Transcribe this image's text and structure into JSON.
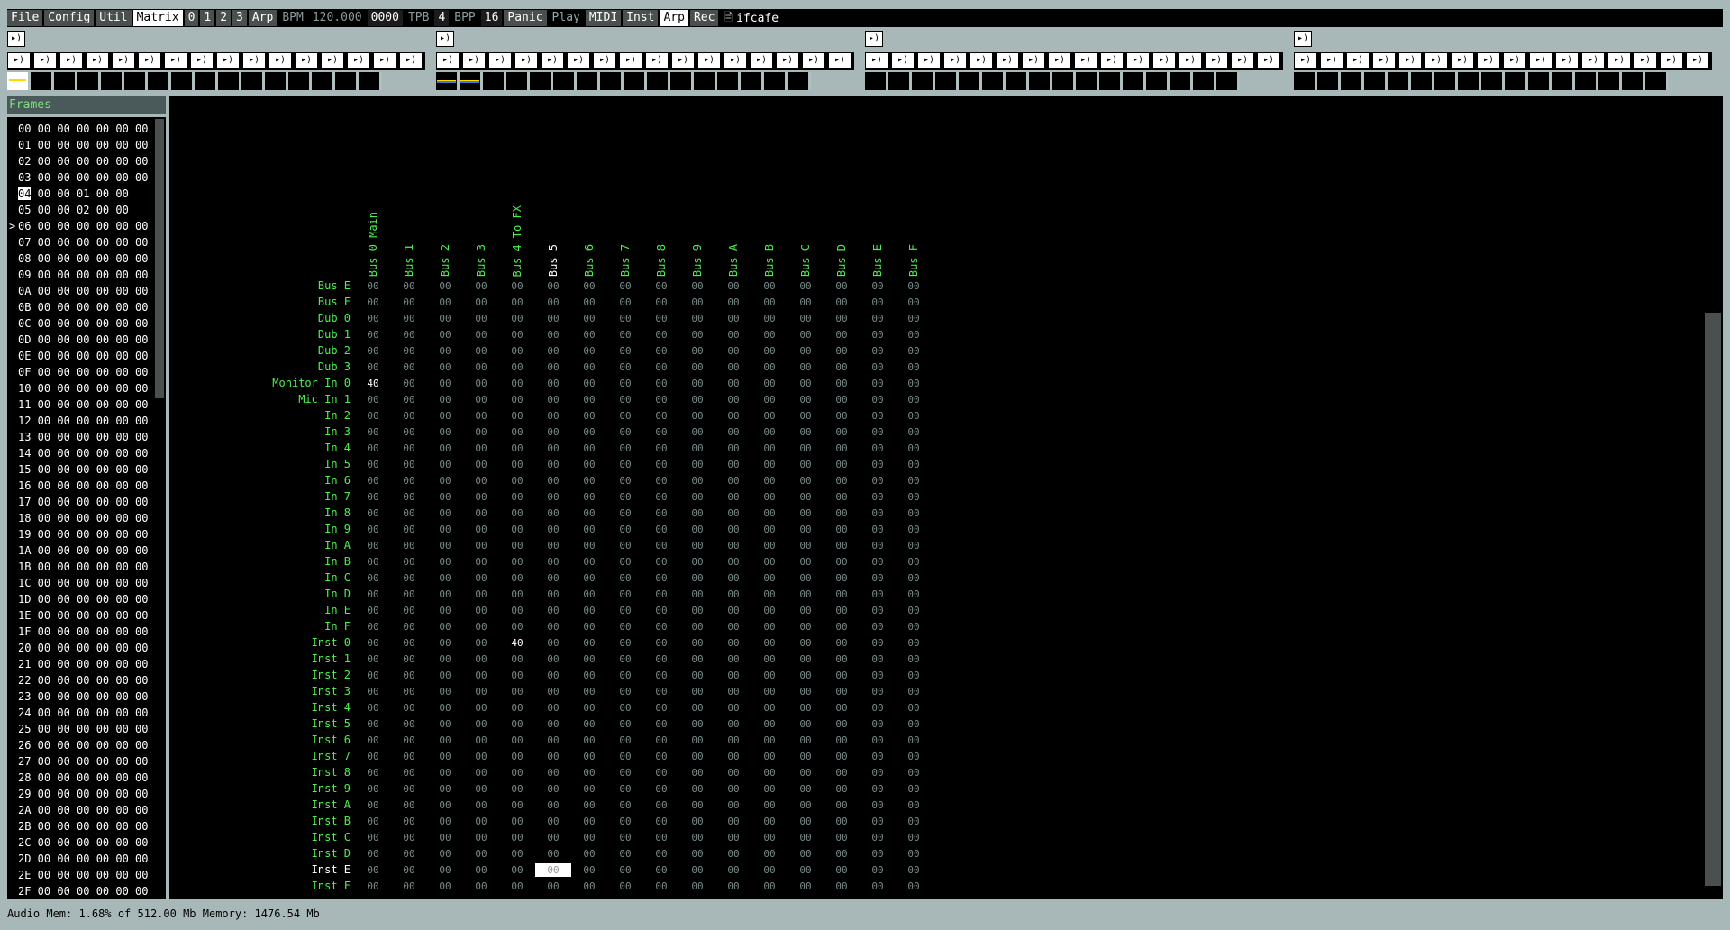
{
  "menubar": {
    "items": [
      "File",
      "Config",
      "Util",
      "Matrix",
      "0",
      "1",
      "2",
      "3",
      "Arp"
    ],
    "selected": "Matrix",
    "bpm_label": "BPM",
    "bpm_value": "120.000",
    "counter": "0000",
    "tpb_label": "TPB",
    "tpb_value": "4",
    "bpp_label": "BPP",
    "bpp_value": "16",
    "panic": "Panic",
    "play": "Play",
    "midi": "MIDI",
    "inst": "Inst",
    "arp": "Arp",
    "rec": "Rec",
    "song_name": "ifcafe"
  },
  "strip": {
    "group_button_icon": "speaker-icon",
    "channel_button_icon": "speaker-icon",
    "groups": 4,
    "channels_per_group": 16
  },
  "frames": {
    "title": "Frames",
    "current_marker": ">",
    "current_index": 6,
    "highlighted_index": 4,
    "rows": [
      {
        "idx": "00",
        "vals": "00 00 00 00 00 00"
      },
      {
        "idx": "01",
        "vals": "00 00 00 00 00 00"
      },
      {
        "idx": "02",
        "vals": "00 00 00 00 00 00"
      },
      {
        "idx": "03",
        "vals": "00 00 00 00 00 00"
      },
      {
        "idx": "04",
        "vals": "00 00 01 00 00"
      },
      {
        "idx": "05",
        "vals": "00 00 02 00 00"
      },
      {
        "idx": "06",
        "vals": "00 00 00 00 00 00"
      },
      {
        "idx": "07",
        "vals": "00 00 00 00 00 00"
      },
      {
        "idx": "08",
        "vals": "00 00 00 00 00 00"
      },
      {
        "idx": "09",
        "vals": "00 00 00 00 00 00"
      },
      {
        "idx": "0A",
        "vals": "00 00 00 00 00 00"
      },
      {
        "idx": "0B",
        "vals": "00 00 00 00 00 00"
      },
      {
        "idx": "0C",
        "vals": "00 00 00 00 00 00"
      },
      {
        "idx": "0D",
        "vals": "00 00 00 00 00 00"
      },
      {
        "idx": "0E",
        "vals": "00 00 00 00 00 00"
      },
      {
        "idx": "0F",
        "vals": "00 00 00 00 00 00"
      },
      {
        "idx": "10",
        "vals": "00 00 00 00 00 00"
      },
      {
        "idx": "11",
        "vals": "00 00 00 00 00 00"
      },
      {
        "idx": "12",
        "vals": "00 00 00 00 00 00"
      },
      {
        "idx": "13",
        "vals": "00 00 00 00 00 00"
      },
      {
        "idx": "14",
        "vals": "00 00 00 00 00 00"
      },
      {
        "idx": "15",
        "vals": "00 00 00 00 00 00"
      },
      {
        "idx": "16",
        "vals": "00 00 00 00 00 00"
      },
      {
        "idx": "17",
        "vals": "00 00 00 00 00 00"
      },
      {
        "idx": "18",
        "vals": "00 00 00 00 00 00"
      },
      {
        "idx": "19",
        "vals": "00 00 00 00 00 00"
      },
      {
        "idx": "1A",
        "vals": "00 00 00 00 00 00"
      },
      {
        "idx": "1B",
        "vals": "00 00 00 00 00 00"
      },
      {
        "idx": "1C",
        "vals": "00 00 00 00 00 00"
      },
      {
        "idx": "1D",
        "vals": "00 00 00 00 00 00"
      },
      {
        "idx": "1E",
        "vals": "00 00 00 00 00 00"
      },
      {
        "idx": "1F",
        "vals": "00 00 00 00 00 00"
      },
      {
        "idx": "20",
        "vals": "00 00 00 00 00 00"
      },
      {
        "idx": "21",
        "vals": "00 00 00 00 00 00"
      },
      {
        "idx": "22",
        "vals": "00 00 00 00 00 00"
      },
      {
        "idx": "23",
        "vals": "00 00 00 00 00 00"
      },
      {
        "idx": "24",
        "vals": "00 00 00 00 00 00"
      },
      {
        "idx": "25",
        "vals": "00 00 00 00 00 00"
      },
      {
        "idx": "26",
        "vals": "00 00 00 00 00 00"
      },
      {
        "idx": "27",
        "vals": "00 00 00 00 00 00"
      },
      {
        "idx": "28",
        "vals": "00 00 00 00 00 00"
      },
      {
        "idx": "29",
        "vals": "00 00 00 00 00 00"
      },
      {
        "idx": "2A",
        "vals": "00 00 00 00 00 00"
      },
      {
        "idx": "2B",
        "vals": "00 00 00 00 00 00"
      },
      {
        "idx": "2C",
        "vals": "00 00 00 00 00 00"
      },
      {
        "idx": "2D",
        "vals": "00 00 00 00 00 00"
      },
      {
        "idx": "2E",
        "vals": "00 00 00 00 00 00"
      },
      {
        "idx": "2F",
        "vals": "00 00 00 00 00 00"
      }
    ]
  },
  "matrix": {
    "columns": [
      "Bus 0 Main",
      "Bus 1",
      "Bus 2",
      "Bus 3",
      "Bus 4 To FX",
      "Bus 5",
      "Bus 6",
      "Bus 7",
      "Bus 8",
      "Bus 9",
      "Bus A",
      "Bus B",
      "Bus C",
      "Bus D",
      "Bus E",
      "Bus F"
    ],
    "selected_column": 5,
    "rows": [
      "Bus E",
      "Bus F",
      "Dub 0",
      "Dub 1",
      "Dub 2",
      "Dub 3",
      "Monitor In 0",
      "Mic In 1",
      "In 2",
      "In 3",
      "In 4",
      "In 5",
      "In 6",
      "In 7",
      "In 8",
      "In 9",
      "In A",
      "In B",
      "In C",
      "In D",
      "In E",
      "In F",
      "Inst 0",
      "Inst 1",
      "Inst 2",
      "Inst 3",
      "Inst 4",
      "Inst 5",
      "Inst 6",
      "Inst 7",
      "Inst 8",
      "Inst 9",
      "Inst A",
      "Inst B",
      "Inst C",
      "Inst D",
      "Inst E",
      "Inst F"
    ],
    "selected_row": 36,
    "default_value": "00",
    "nonzero": [
      {
        "row": 6,
        "col": 0,
        "value": "40"
      },
      {
        "row": 22,
        "col": 4,
        "value": "40"
      }
    ],
    "cursor": {
      "row": 36,
      "col": 5
    }
  },
  "status": {
    "text": "Audio Mem: 1.68% of 512.00 Mb Memory: 1476.54 Mb"
  },
  "colors": {
    "label_green": "#4cf04c",
    "value_gray": "#7a8a8a",
    "background": "#a8b8b8"
  }
}
